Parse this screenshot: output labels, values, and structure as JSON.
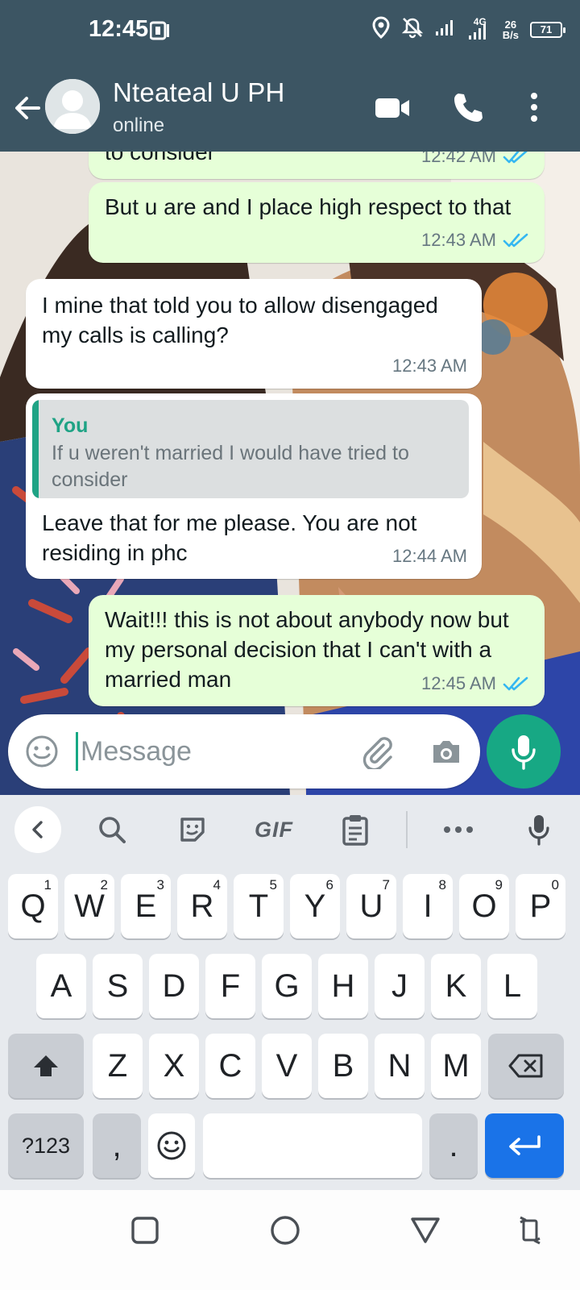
{
  "status_bar": {
    "time": "12:45",
    "network_type": "4G",
    "net_speed_value": "26",
    "net_speed_unit": "B/s",
    "battery": "71"
  },
  "app_bar": {
    "contact_name": "Nteateal U PH",
    "contact_status": "online"
  },
  "messages": [
    {
      "direction": "outgoing",
      "text": "to consider",
      "time": "12:42 AM",
      "read": true
    },
    {
      "direction": "outgoing",
      "text": "But u are and I place high respect to that",
      "time": "12:43 AM",
      "read": true
    },
    {
      "direction": "incoming",
      "text": "I mine that told you to allow disengaged my calls is calling?",
      "time": "12:43 AM"
    },
    {
      "direction": "incoming",
      "quote_sender": "You",
      "quote_text": "If u weren't married I would have tried to consider",
      "text": "Leave that for me please.  You are not residing in phc",
      "time": "12:44 AM"
    },
    {
      "direction": "outgoing",
      "text": "Wait!!! this is not about anybody now but my personal decision that I can't with a married man",
      "time": "12:45 AM",
      "read": true
    }
  ],
  "composer": {
    "placeholder": "Message"
  },
  "keyboard": {
    "toolbar_gif": "GIF",
    "row1": [
      {
        "key": "Q",
        "hint": "1"
      },
      {
        "key": "W",
        "hint": "2"
      },
      {
        "key": "E",
        "hint": "3"
      },
      {
        "key": "R",
        "hint": "4"
      },
      {
        "key": "T",
        "hint": "5"
      },
      {
        "key": "Y",
        "hint": "6"
      },
      {
        "key": "U",
        "hint": "7"
      },
      {
        "key": "I",
        "hint": "8"
      },
      {
        "key": "O",
        "hint": "9"
      },
      {
        "key": "P",
        "hint": "0"
      }
    ],
    "row2": [
      "A",
      "S",
      "D",
      "F",
      "G",
      "H",
      "J",
      "K",
      "L"
    ],
    "row3": [
      "Z",
      "X",
      "C",
      "V",
      "B",
      "N",
      "M"
    ],
    "symbols_key": "?123",
    "comma_key": ",",
    "period_key": "."
  },
  "colors": {
    "header": "#3c5563",
    "accent": "#17a884",
    "outgoing_bubble": "#e6ffd8",
    "read_tick": "#34b7f1"
  },
  "icons": {
    "header": [
      "back-arrow-icon",
      "avatar-icon",
      "video-camera-icon",
      "phone-icon",
      "more-vert-icon"
    ],
    "composer": [
      "emoji-icon",
      "paperclip-icon",
      "camera-icon",
      "mic-icon"
    ],
    "keyboard_toolbar": [
      "chevron-left-icon",
      "search-icon",
      "sticker-icon",
      "clipboard-icon",
      "more-horiz-icon",
      "mic-icon"
    ],
    "nav": [
      "recents-square-icon",
      "home-circle-icon",
      "back-triangle-icon",
      "rotate-icon"
    ]
  }
}
